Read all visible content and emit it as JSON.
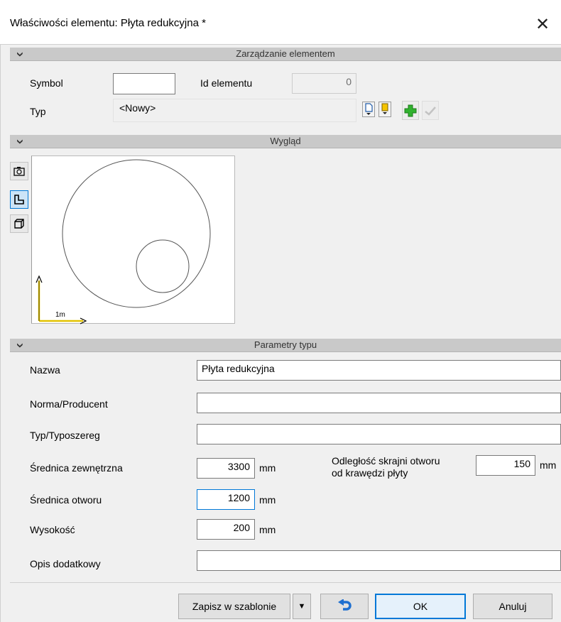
{
  "window": {
    "title": "Właściwości elementu: Płyta redukcyjna *",
    "close_glyph": "✕"
  },
  "sections": {
    "management": "Zarządzanie elementem",
    "appearance": "Wygląd",
    "type_params": "Parametry typu",
    "collapse_glyph": "❯"
  },
  "management": {
    "symbol_label": "Symbol",
    "symbol_value": "",
    "id_label": "Id elementu",
    "id_value": "0",
    "type_label": "Typ",
    "type_value": "<Nowy>"
  },
  "preview": {
    "scale_label": "1m",
    "tools": [
      "camera-icon",
      "plan-view-icon",
      "3d-view-icon"
    ]
  },
  "params": {
    "name_label": "Nazwa",
    "name_value": "Płyta redukcyjna",
    "norm_label": "Norma/Producent",
    "norm_value": "",
    "series_label": "Typ/Typoszereg",
    "series_value": "",
    "outer_diam_label": "Średnica zewnętrzna",
    "outer_diam_value": "3300",
    "hole_diam_label": "Średnica otworu",
    "hole_diam_value": "1200",
    "height_label": "Wysokość",
    "height_value": "200",
    "edge_dist_label_1": "Odległość skrajni otworu",
    "edge_dist_label_2": "od krawędzi płyty",
    "edge_dist_value": "150",
    "extra_label": "Opis dodatkowy",
    "extra_value": "",
    "unit": "mm"
  },
  "footer": {
    "save_template": "Zapisz w szablonie",
    "dropdown_glyph": "▼",
    "ok": "OK",
    "cancel": "Anuluj"
  }
}
